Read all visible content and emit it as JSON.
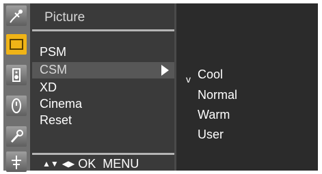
{
  "menu": {
    "title": "Picture",
    "items": [
      {
        "label": "PSM"
      },
      {
        "label": "CSM"
      },
      {
        "label": "XD"
      },
      {
        "label": "Cinema"
      },
      {
        "label": "Reset"
      }
    ]
  },
  "submenu": {
    "selected_mark": "v",
    "options": [
      {
        "label": "Cool"
      },
      {
        "label": "Normal"
      },
      {
        "label": "Warm"
      },
      {
        "label": "User"
      }
    ]
  },
  "help": {
    "updown_symbol": "▲▼",
    "leftright_symbol": "◀▶",
    "ok_label": "OK",
    "menu_label": "MENU"
  },
  "sidebar_icons": [
    "satellite-icon",
    "picture-icon",
    "speaker-icon",
    "clock-icon",
    "wrench-icon",
    "antenna-icon"
  ],
  "colors": {
    "osd_background": "#3a3a3a",
    "icon_bar": "#707070",
    "active_icon": "#f0b417",
    "highlight_row": "#575757"
  }
}
